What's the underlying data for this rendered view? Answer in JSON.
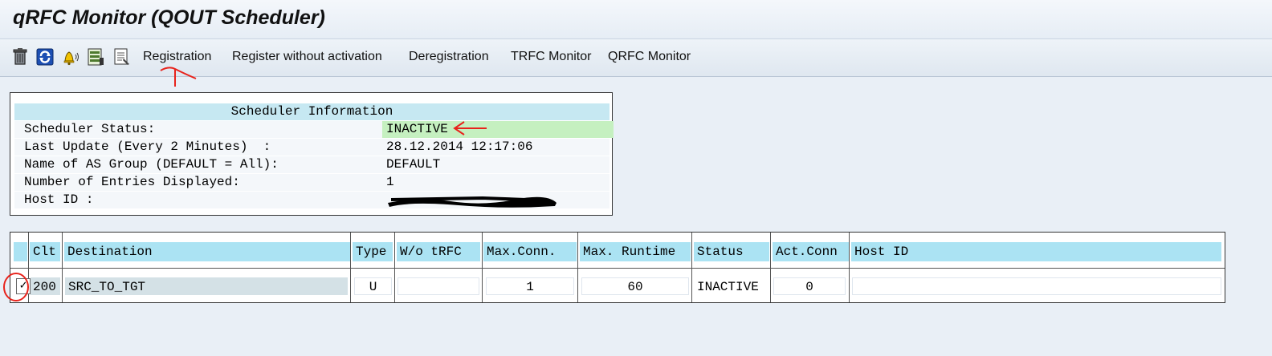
{
  "window": {
    "title": "qRFC Monitor (QOUT Scheduler)"
  },
  "toolbar": {
    "icons": [
      "trash-icon",
      "refresh-icon",
      "alert-bell-icon",
      "list-detail-icon",
      "document-icon"
    ],
    "buttons": [
      "Registration",
      "Register without activation",
      "Deregistration",
      "TRFC Monitor",
      "QRFC Monitor"
    ]
  },
  "scheduler_info": {
    "header": "Scheduler Information",
    "rows": [
      {
        "label": "Scheduler Status:",
        "value": "INACTIVE"
      },
      {
        "label": "Last Update (Every 2 Minutes)  :",
        "value": "28.12.2014 12:17:06"
      },
      {
        "label": "Name of AS Group (DEFAULT = All):",
        "value": "DEFAULT"
      },
      {
        "label": "Number of Entries Displayed:",
        "value": "1"
      },
      {
        "label": "Host ID :",
        "value": ""
      }
    ],
    "status_color": "#c5f0c0"
  },
  "table": {
    "columns": [
      "Clt",
      "Destination",
      "Type",
      "W/o tRFC",
      "Max.Conn.",
      "Max. Runtime",
      "Status",
      "Act.Conn",
      "Host ID"
    ],
    "rows": [
      {
        "selected": true,
        "check_glyph": "✓",
        "clt": "200",
        "destination": "SRC_TO_TGT",
        "type": "U",
        "wo_trfc": "",
        "max_conn": "1",
        "max_runtime": "60",
        "status": "INACTIVE",
        "act_conn": "0",
        "host_id": ""
      }
    ],
    "header_color": "#abe3f3"
  },
  "annotations": {
    "color": "#e8231c"
  }
}
